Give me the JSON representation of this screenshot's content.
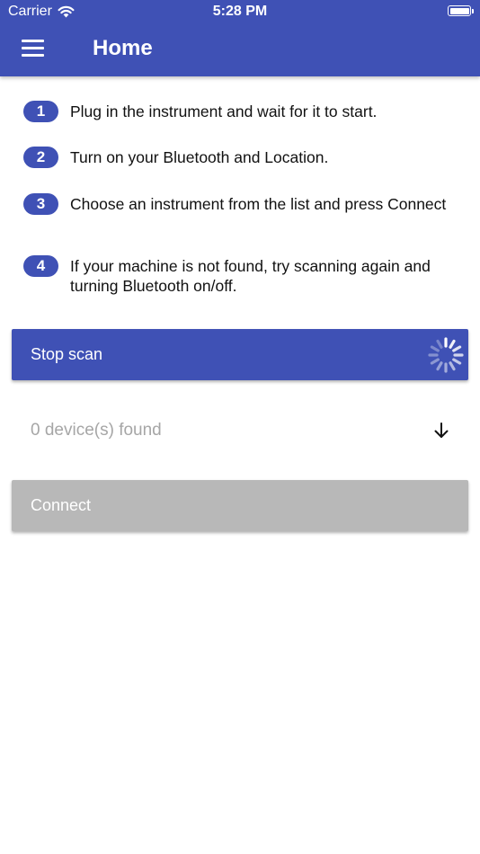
{
  "status_bar": {
    "carrier": "Carrier",
    "time": "5:28 PM"
  },
  "header": {
    "title": "Home",
    "menu_icon": "hamburger-menu-icon",
    "color": "#3f51b5"
  },
  "steps": [
    {
      "number": "1",
      "text": "Plug in the instrument and wait for it to start."
    },
    {
      "number": "2",
      "text": "Turn on your Bluetooth and Location."
    },
    {
      "number": "3",
      "text": "Choose an instrument from the list and press Connect"
    },
    {
      "number": "4",
      "text": "If your machine is not found, try scanning again and turning Bluetooth on/off."
    }
  ],
  "scan_button": {
    "label": "Stop scan",
    "icon": "loading-spinner-icon"
  },
  "device_select": {
    "value": "0 device(s) found",
    "icon": "arrow-down-icon"
  },
  "connect_button": {
    "label": "Connect"
  }
}
